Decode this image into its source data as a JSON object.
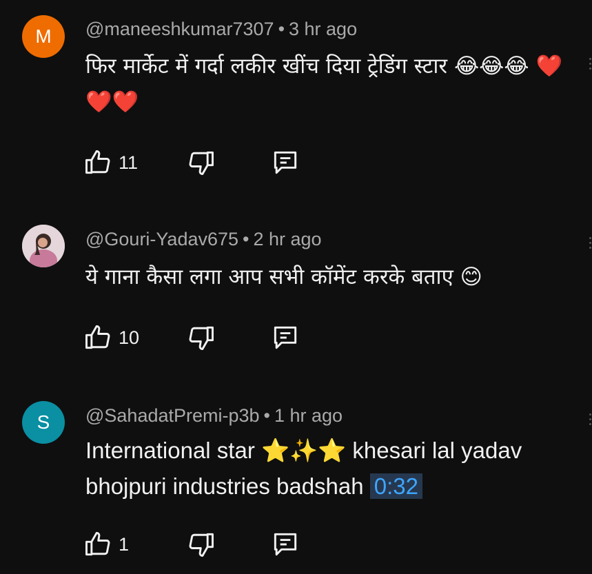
{
  "comments": [
    {
      "avatar_letter": "M",
      "avatar_color": "#ef6c00",
      "handle": "@maneeshkumar7307",
      "time": "3 hr ago",
      "text": "फिर मार्केट में गर्दा लकीर खींच दिया ट्रेडिंग स्टार 😂😂😂 ❤️❤️❤️",
      "likes": "11"
    },
    {
      "avatar_letter": "",
      "avatar_color": "#c9b0b8",
      "handle": "@Gouri-Yadav675",
      "time": "2 hr ago",
      "text": "ये गाना कैसा लगा आप सभी कॉमेंट करके बताए 😊",
      "likes": "10"
    },
    {
      "avatar_letter": "S",
      "avatar_color": "#0a8fa3",
      "handle": "@SahadatPremi-p3b",
      "time": "1 hr ago",
      "text": "International star ⭐✨⭐ khesari lal yadav bhojpuri industries badshah",
      "timestamp_link": "0:32",
      "likes": "1"
    }
  ],
  "separator": "•",
  "icons": {
    "like": "thumbs-up-icon",
    "dislike": "thumbs-down-icon",
    "reply": "reply-comment-icon"
  }
}
